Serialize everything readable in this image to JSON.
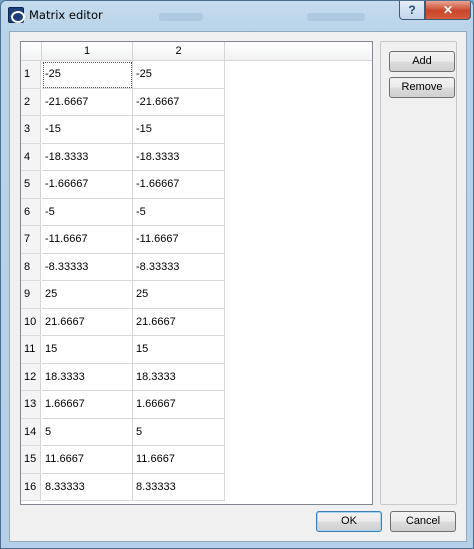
{
  "window": {
    "title": "Matrix editor",
    "help_glyph": "?",
    "close_glyph": "✕",
    "icon": "matrix-editor-app-icon"
  },
  "table": {
    "columns": [
      "1",
      "2"
    ],
    "row_numbers": [
      "1",
      "2",
      "3",
      "4",
      "5",
      "6",
      "7",
      "8",
      "9",
      "10",
      "11",
      "12",
      "13",
      "14",
      "15",
      "16"
    ],
    "rows": [
      [
        "-25",
        "-25"
      ],
      [
        "-21.6667",
        "-21.6667"
      ],
      [
        "-15",
        "-15"
      ],
      [
        "-18.3333",
        "-18.3333"
      ],
      [
        "-1.66667",
        "-1.66667"
      ],
      [
        "-5",
        "-5"
      ],
      [
        "-11.6667",
        "-11.6667"
      ],
      [
        "-8.33333",
        "-8.33333"
      ],
      [
        "25",
        "25"
      ],
      [
        "21.6667",
        "21.6667"
      ],
      [
        "15",
        "15"
      ],
      [
        "18.3333",
        "18.3333"
      ],
      [
        "1.66667",
        "1.66667"
      ],
      [
        "5",
        "5"
      ],
      [
        "11.6667",
        "11.6667"
      ],
      [
        "8.33333",
        "8.33333"
      ]
    ],
    "selected_cell": [
      0,
      0
    ]
  },
  "side_buttons": {
    "add_label": "Add",
    "remove_label": "Remove"
  },
  "footer": {
    "ok_label": "OK",
    "cancel_label": "Cancel"
  },
  "colors": {
    "title_bar": "#b9d3e8",
    "close_button": "#c9452a",
    "default_button_border": "#3c7fb1"
  }
}
